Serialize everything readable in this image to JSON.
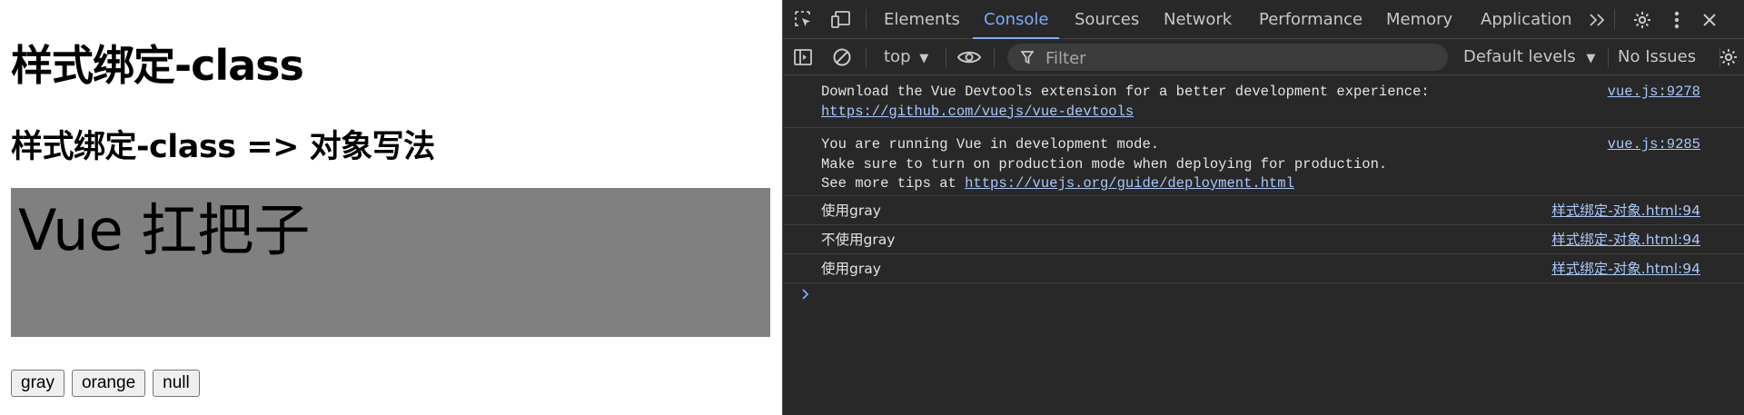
{
  "page": {
    "title": "样式绑定-class",
    "subtitle": "样式绑定-class => 对象写法",
    "box_text": "Vue 扛把子",
    "box_color": "#808080",
    "buttons": [
      {
        "label": "gray"
      },
      {
        "label": "orange"
      },
      {
        "label": "null"
      }
    ]
  },
  "devtools": {
    "tabs": [
      "Elements",
      "Console",
      "Sources",
      "Network",
      "Performance",
      "Memory",
      "Application"
    ],
    "active_tab": "Console",
    "toolbar": {
      "context": "top",
      "filter_placeholder": "Filter",
      "levels": "Default levels",
      "issues": "No Issues"
    },
    "messages": [
      {
        "lines": [
          "Download the Vue Devtools extension for a better development experience:"
        ],
        "link": "https://github.com/vuejs/vue-devtools",
        "source": "vue.js:9278"
      },
      {
        "lines": [
          "You are running Vue in development mode.",
          "Make sure to turn on production mode when deploying for production."
        ],
        "prefix": "See more tips at ",
        "link": "https://vuejs.org/guide/deployment.html",
        "source": "vue.js:9285"
      },
      {
        "text": "使用gray",
        "source": "样式绑定-对象.html:94"
      },
      {
        "text": "不使用gray",
        "source": "样式绑定-对象.html:94"
      },
      {
        "text": "使用gray",
        "source": "样式绑定-对象.html:94"
      }
    ],
    "accent_color": "#7cacf8"
  }
}
